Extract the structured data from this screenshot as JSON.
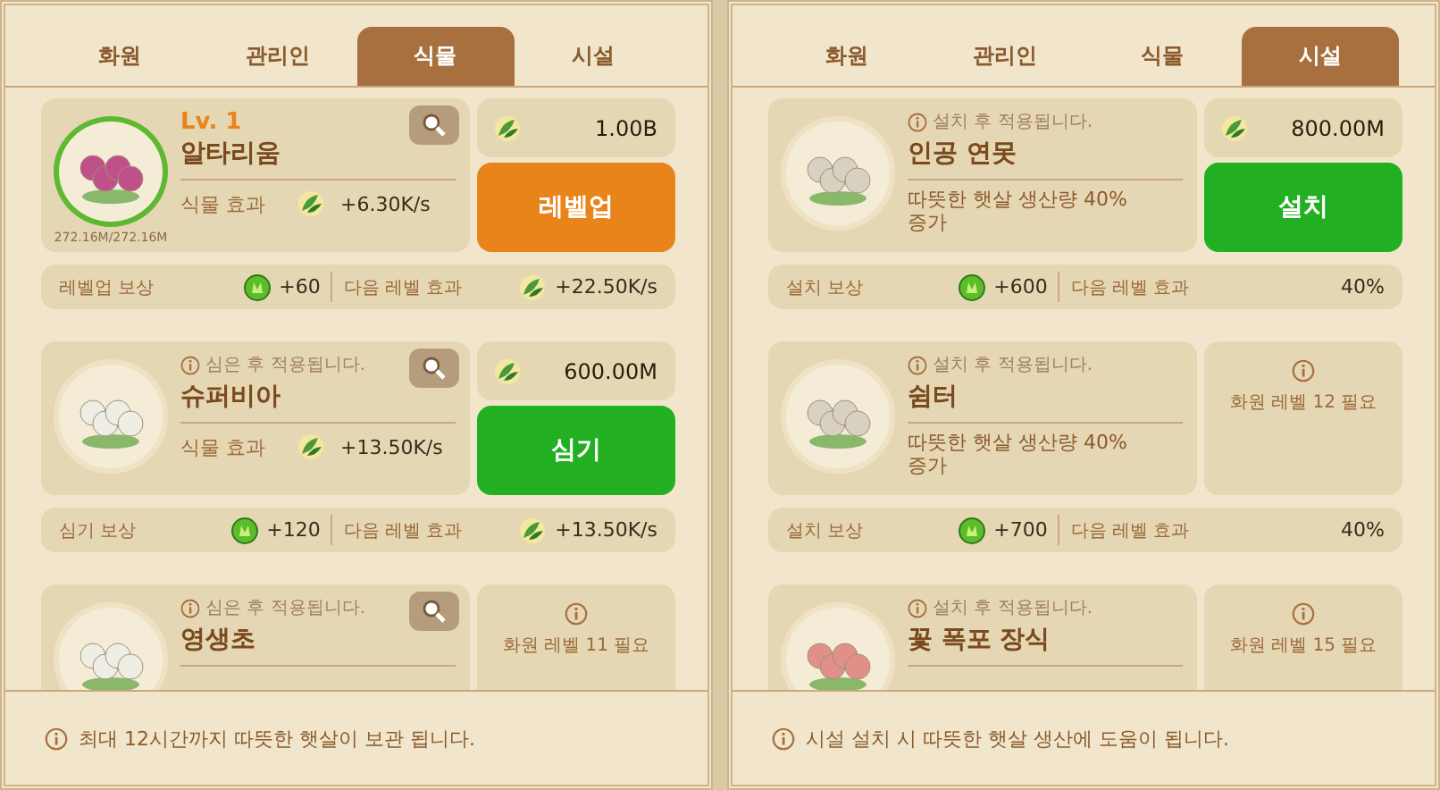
{
  "panels": [
    {
      "tabs": [
        {
          "label": "화원",
          "selected": false
        },
        {
          "label": "관리인",
          "selected": false
        },
        {
          "label": "식물",
          "selected": true
        },
        {
          "label": "시설",
          "selected": false
        }
      ],
      "items": [
        {
          "kind": "plant",
          "owned": true,
          "level": "Lv. 1",
          "name": "알타리움",
          "capacity": "272.16M/272.16M",
          "effect_label": "식물 효과",
          "effect_value": "+6.30K/s",
          "action": {
            "kind": "buy",
            "cost": "1.00B",
            "button": "레벨업",
            "color": "#e8841a"
          },
          "reward": {
            "label": "레벨업 보상",
            "value": "+60",
            "next_label": "다음 레벨 효과",
            "next_value": "+22.50K/s"
          }
        },
        {
          "kind": "plant",
          "owned": false,
          "notice": "심은 후 적용됩니다.",
          "name": "슈퍼비아",
          "effect_label": "식물 효과",
          "effect_value": "+13.50K/s",
          "action": {
            "kind": "buy",
            "cost": "600.00M",
            "button": "심기",
            "color": "#22b022"
          },
          "reward": {
            "label": "심기 보상",
            "value": "+120",
            "next_label": "다음 레벨 효과",
            "next_value": "+13.50K/s"
          }
        },
        {
          "kind": "plant",
          "owned": false,
          "notice": "심은 후 적용됩니다.",
          "name": "영생초",
          "action": {
            "kind": "locked",
            "text": "화원 레벨 11 필요"
          }
        }
      ],
      "footer": "최대 12시간까지 따뜻한 햇살이 보관 됩니다."
    },
    {
      "tabs": [
        {
          "label": "화원",
          "selected": false
        },
        {
          "label": "관리인",
          "selected": false
        },
        {
          "label": "식물",
          "selected": false
        },
        {
          "label": "시설",
          "selected": true
        }
      ],
      "items": [
        {
          "kind": "facility",
          "owned": false,
          "notice": "설치 후 적용됩니다.",
          "name": "인공 연못",
          "description": "따뜻한 햇살 생산량 40% 증가",
          "action": {
            "kind": "buy",
            "cost": "800.00M",
            "button": "설치",
            "color": "#22b022"
          },
          "reward": {
            "label": "설치 보상",
            "value": "+600",
            "next_label": "다음 레벨 효과",
            "next_value": "40%"
          }
        },
        {
          "kind": "facility",
          "owned": false,
          "notice": "설치 후 적용됩니다.",
          "name": "쉼터",
          "description": "따뜻한 햇살 생산량 40% 증가",
          "action": {
            "kind": "locked",
            "text": "화원 레벨 12 필요"
          },
          "reward": {
            "label": "설치 보상",
            "value": "+700",
            "next_label": "다음 레벨 효과",
            "next_value": "40%"
          }
        },
        {
          "kind": "facility",
          "owned": false,
          "notice": "설치 후 적용됩니다.",
          "name": "꽃 폭포 장식",
          "action": {
            "kind": "locked",
            "text": "화원 레벨 15 필요"
          }
        }
      ],
      "footer": "시설 설치 시 따뜻한 햇살 생산에 도움이 됩니다."
    }
  ]
}
